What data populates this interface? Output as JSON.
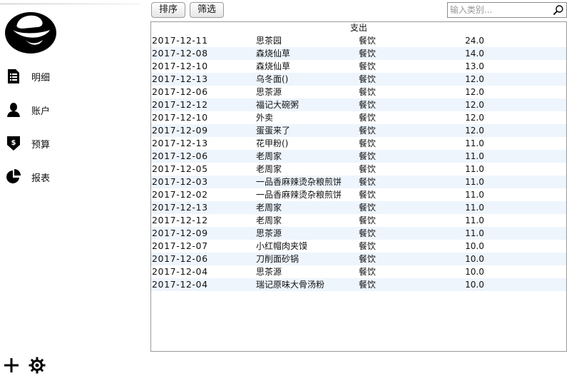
{
  "sidebar": {
    "items": [
      {
        "label": "明细"
      },
      {
        "label": "账户"
      },
      {
        "label": "预算"
      },
      {
        "label": "报表"
      }
    ]
  },
  "toolbar": {
    "sort_label": "排序",
    "filter_label": "筛选"
  },
  "search": {
    "placeholder": "输入类别..."
  },
  "table": {
    "header": "支出",
    "rows": [
      {
        "date": "2017-12-11",
        "name": "思茶园",
        "category": "餐饮",
        "amount": "24.0"
      },
      {
        "date": "2017-12-08",
        "name": "森烧仙草",
        "category": "餐饮",
        "amount": "14.0"
      },
      {
        "date": "2017-12-10",
        "name": "森烧仙草",
        "category": "餐饮",
        "amount": "13.0"
      },
      {
        "date": "2017-12-13",
        "name": "乌冬面()",
        "category": "餐饮",
        "amount": "12.0"
      },
      {
        "date": "2017-12-06",
        "name": "思茶源",
        "category": "餐饮",
        "amount": "12.0"
      },
      {
        "date": "2017-12-12",
        "name": "福记大碗粥",
        "category": "餐饮",
        "amount": "12.0"
      },
      {
        "date": "2017-12-10",
        "name": "外卖",
        "category": "餐饮",
        "amount": "12.0"
      },
      {
        "date": "2017-12-09",
        "name": "蛋蛋来了",
        "category": "餐饮",
        "amount": "12.0"
      },
      {
        "date": "2017-12-13",
        "name": "花甲粉()",
        "category": "餐饮",
        "amount": "11.0"
      },
      {
        "date": "2017-12-06",
        "name": "老周家",
        "category": "餐饮",
        "amount": "11.0"
      },
      {
        "date": "2017-12-05",
        "name": "老周家",
        "category": "餐饮",
        "amount": "11.0"
      },
      {
        "date": "2017-12-03",
        "name": "一品香麻辣烫杂粮煎饼",
        "category": "餐饮",
        "amount": "11.0"
      },
      {
        "date": "2017-12-02",
        "name": "一品香麻辣烫杂粮煎饼",
        "category": "餐饮",
        "amount": "11.0"
      },
      {
        "date": "2017-12-13",
        "name": "老周家",
        "category": "餐饮",
        "amount": "11.0"
      },
      {
        "date": "2017-12-12",
        "name": "老周家",
        "category": "餐饮",
        "amount": "11.0"
      },
      {
        "date": "2017-12-09",
        "name": "思茶源",
        "category": "餐饮",
        "amount": "11.0"
      },
      {
        "date": "2017-12-07",
        "name": "小红帽肉夹馍",
        "category": "餐饮",
        "amount": "10.0"
      },
      {
        "date": "2017-12-06",
        "name": "刀削面砂锅",
        "category": "餐饮",
        "amount": "10.0"
      },
      {
        "date": "2017-12-04",
        "name": "思茶源",
        "category": "餐饮",
        "amount": "10.0"
      },
      {
        "date": "2017-12-04",
        "name": "瑞记原味大骨汤粉",
        "category": "餐饮",
        "amount": "10.0"
      }
    ]
  },
  "icons": {
    "logo": "redhat-logo-icon",
    "details": "document-list-icon",
    "account": "user-icon",
    "budget": "budget-shield-icon",
    "report": "pie-chart-icon",
    "add": "plus-icon",
    "settings": "gear-icon",
    "search": "magnifier-icon"
  },
  "colors": {
    "row_alt": "#eef5fd",
    "border": "#9a9a9a"
  }
}
